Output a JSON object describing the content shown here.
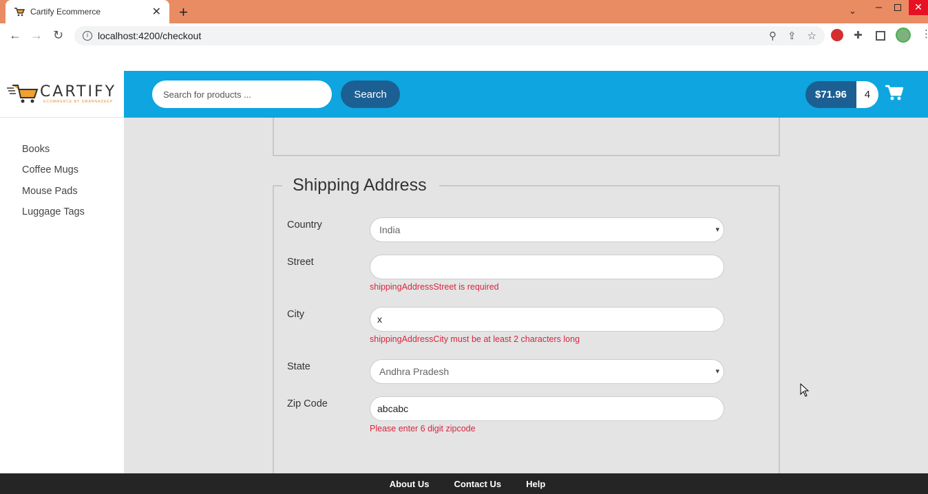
{
  "browser": {
    "tab_title": "Cartify Ecommerce",
    "url": "localhost:4200/checkout"
  },
  "logo": {
    "word": "CARTIFY",
    "tagline": "ECOMMERCE BY SWARNADEEP"
  },
  "header": {
    "search_placeholder": "Search for products ...",
    "search_button": "Search",
    "cart_total": "$71.96",
    "cart_count": "4"
  },
  "sidebar": {
    "items": [
      {
        "label": "Books"
      },
      {
        "label": "Coffee Mugs"
      },
      {
        "label": "Mouse Pads"
      },
      {
        "label": "Luggage Tags"
      }
    ]
  },
  "shipping": {
    "legend": "Shipping Address",
    "country_label": "Country",
    "country_value": "India",
    "street_label": "Street",
    "street_value": "",
    "street_error": "shippingAddressStreet is required",
    "city_label": "City",
    "city_value": "x",
    "city_error": "shippingAddressCity must be at least 2 characters long",
    "state_label": "State",
    "state_value": "Andhra Pradesh",
    "zip_label": "Zip Code",
    "zip_value": "abcabc",
    "zip_error": "Please enter 6 digit zipcode"
  },
  "footer": {
    "links": [
      {
        "label": "About Us"
      },
      {
        "label": "Contact Us"
      },
      {
        "label": "Help"
      }
    ]
  },
  "colors": {
    "tabbar": "#e98c63",
    "header": "#0ea5e0",
    "button": "#1c5f93",
    "error": "#d7263d",
    "footer": "#252525"
  }
}
